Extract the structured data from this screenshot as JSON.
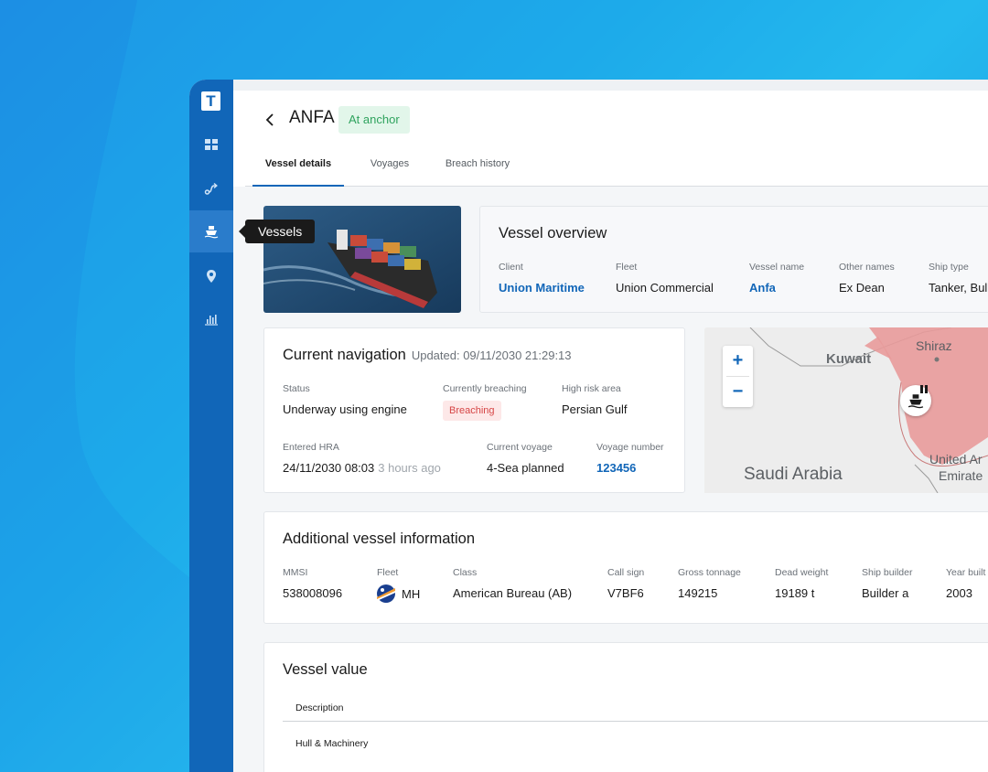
{
  "sidebar": {
    "logo": "T",
    "items": [
      {
        "icon": "dashboard-icon"
      },
      {
        "icon": "routes-icon"
      },
      {
        "icon": "ship-icon",
        "active": true
      },
      {
        "icon": "location-pin-icon"
      },
      {
        "icon": "bar-chart-icon"
      }
    ],
    "tooltip": "Vessels"
  },
  "header": {
    "title": "ANFA",
    "status": "At anchor",
    "tabs": [
      {
        "label": "Vessel details",
        "active": true
      },
      {
        "label": "Voyages"
      },
      {
        "label": "Breach history"
      }
    ]
  },
  "overview": {
    "title": "Vessel overview",
    "fields": [
      {
        "label": "Client",
        "value": "Union Maritime"
      },
      {
        "label": "Fleet",
        "value": "Union Commercial"
      },
      {
        "label": "Vessel name",
        "value": "Anfa"
      },
      {
        "label": "Other names",
        "value": "Ex Dean"
      },
      {
        "label": "Ship type",
        "value": "Tanker, Bul"
      }
    ]
  },
  "navigation": {
    "title": "Current navigation",
    "updated": "Updated: 09/11/2030 21:29:13",
    "status_label": "Status",
    "status_value": "Underway using engine",
    "breaching_label": "Currently breaching",
    "breaching_value": "Breaching",
    "hra_label": "High risk area",
    "hra_value": "Persian Gulf",
    "entered_label": "Entered HRA",
    "entered_value": "24/11/2030 08:03",
    "entered_ago": "3 hours ago",
    "voyage_label": "Current voyage",
    "voyage_value": "4-Sea planned",
    "voyage_num_label": "Voyage number",
    "voyage_num_value": "123456"
  },
  "map": {
    "zoom_in": "+",
    "zoom_out": "−",
    "labels": {
      "kuwait": "Kuwait",
      "shiraz": "Shiraz",
      "saudi": "Saudi Arabia",
      "uae1": "United Ar",
      "uae2": "Emirate"
    },
    "highlight_color": "#e89a9a"
  },
  "additional": {
    "title": "Additional vessel information",
    "fields": [
      {
        "label": "MMSI",
        "value": "538008096"
      },
      {
        "label": "Fleet",
        "value": "MH"
      },
      {
        "label": "Class",
        "value": "American Bureau (AB)"
      },
      {
        "label": "Call sign",
        "value": "V7BF6"
      },
      {
        "label": "Gross tonnage",
        "value": "149215"
      },
      {
        "label": "Dead weight",
        "value": "19189 t"
      },
      {
        "label": "Ship builder",
        "value": "Builder a"
      },
      {
        "label": "Year built",
        "value": "2003"
      }
    ]
  },
  "value": {
    "title": "Vessel value",
    "column": "Description",
    "row": "Hull & Machinery"
  },
  "colors": {
    "brand": "#1166b8",
    "success": "#2fa35e",
    "danger": "#d64545"
  }
}
